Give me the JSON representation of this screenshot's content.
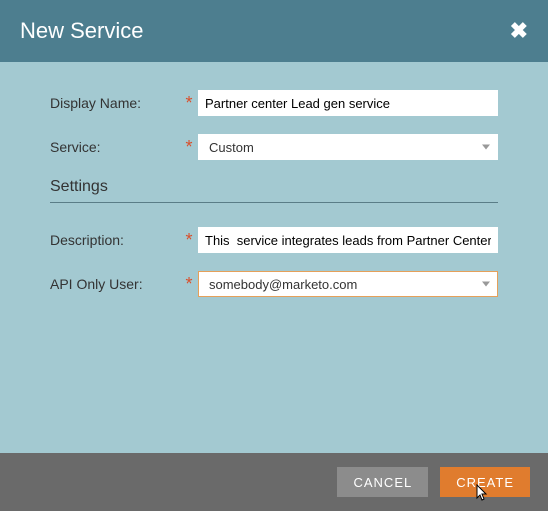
{
  "dialog": {
    "title": "New Service"
  },
  "form": {
    "displayName": {
      "label": "Display Name:",
      "value": "Partner center Lead gen service"
    },
    "service": {
      "label": "Service:",
      "value": "Custom"
    },
    "settingsTitle": "Settings",
    "description": {
      "label": "Description:",
      "value": "This  service integrates leads from Partner Center"
    },
    "apiOnlyUser": {
      "label": "API Only User:",
      "value": "somebody@marketo.com"
    }
  },
  "buttons": {
    "cancel": "CANCEL",
    "create": "CREATE"
  }
}
